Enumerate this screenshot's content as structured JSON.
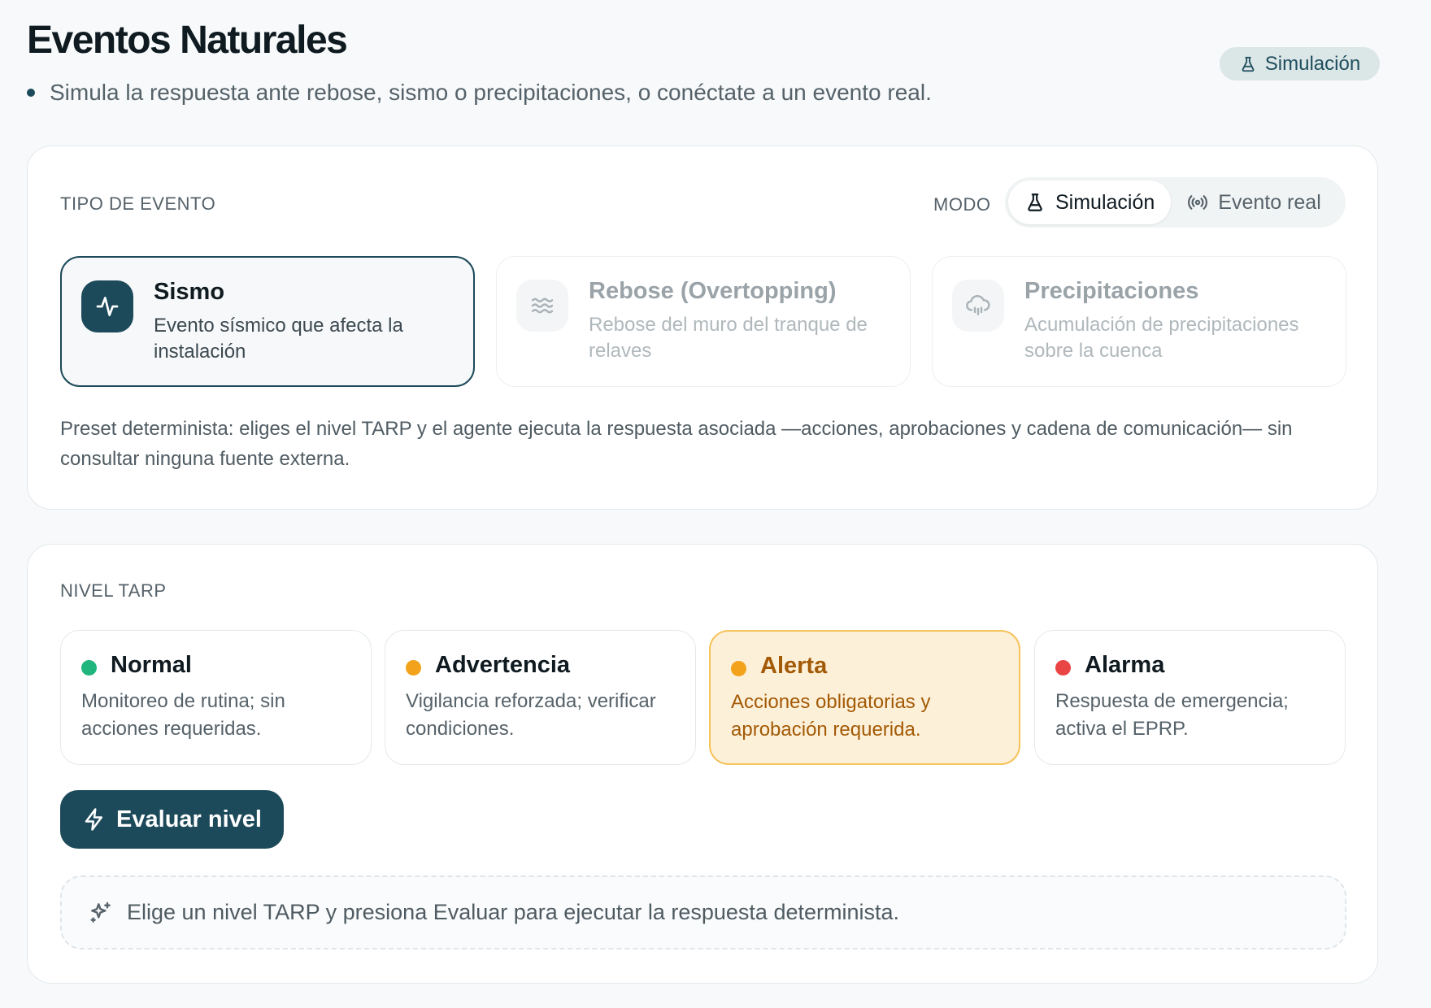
{
  "header": {
    "title": "Eventos Naturales",
    "subtitle": "Simula la respuesta ante rebose, sismo o precipitaciones, o conéctate a un evento real.",
    "badge": "Simulación",
    "badge_icon": "flask-icon"
  },
  "event_card": {
    "section_label": "TIPO DE EVENTO",
    "mode_label": "MODO",
    "modes": [
      {
        "label": "Simulación",
        "icon": "flask-icon",
        "active": true
      },
      {
        "label": "Evento real",
        "icon": "broadcast-icon",
        "active": false
      }
    ],
    "events": [
      {
        "title": "Sismo",
        "desc": "Evento sísmico que afecta la instalación",
        "icon": "activity-icon",
        "selected": true
      },
      {
        "title": "Rebose (Overtopping)",
        "desc": "Rebose del muro del tranque de relaves",
        "icon": "waves-icon",
        "selected": false
      },
      {
        "title": "Precipitaciones",
        "desc": "Acumulación de precipitaciones sobre la cuenca",
        "icon": "cloud-rain-icon",
        "selected": false
      }
    ],
    "preset_text": "Preset determinista: eliges el nivel TARP y el agente ejecuta la respuesta asociada —acciones, aprobaciones y cadena de comunicación— sin consultar ninguna fuente externa."
  },
  "tarp_card": {
    "section_label": "NIVEL TARP",
    "levels": [
      {
        "name": "Normal",
        "desc": "Monitoreo de rutina; sin acciones requeridas.",
        "color": "#1fb57d",
        "selected": false
      },
      {
        "name": "Advertencia",
        "desc": "Vigilancia reforzada; verificar condiciones.",
        "color": "#f2a31b",
        "selected": false
      },
      {
        "name": "Alerta",
        "desc": "Acciones obligatorias y aprobación requerida.",
        "color": "#f2a31b",
        "selected": true
      },
      {
        "name": "Alarma",
        "desc": "Respuesta de emergencia; activa el EPRP.",
        "color": "#e94545",
        "selected": false
      }
    ],
    "evaluate_button": "Evaluar nivel",
    "hint": "Elige un nivel TARP y presiona Evaluar para ejecutar la respuesta determinista."
  },
  "colors": {
    "primary": "#1d4a5a",
    "alert_bg": "#fdf0d9",
    "alert_border": "#f6c25a",
    "alert_text": "#a35a06"
  }
}
